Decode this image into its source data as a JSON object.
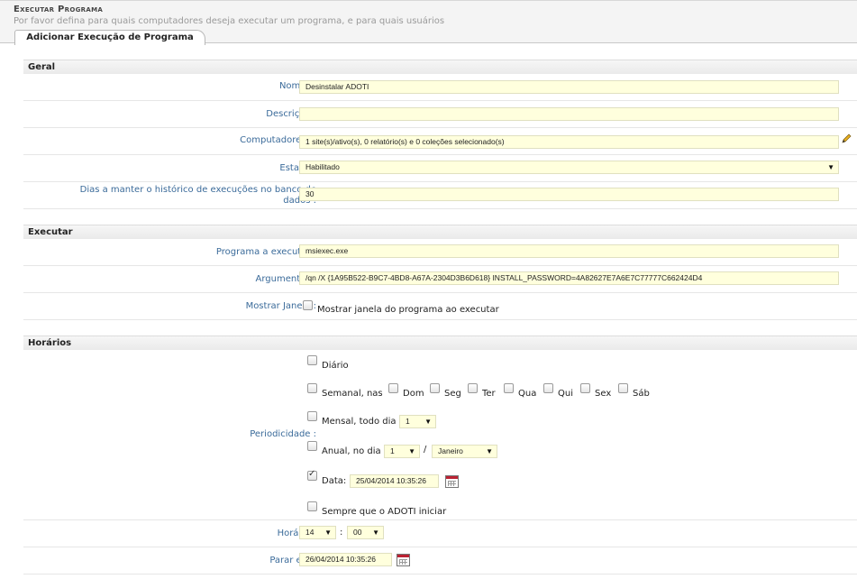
{
  "header": {
    "title": "Executar Programa",
    "subtitle": "Por favor defina para quais computadores deseja executar um programa, e para quais usuários",
    "tab": "Adicionar Execução de Programa"
  },
  "sections": {
    "geral": "Geral",
    "executar": "Executar",
    "horarios": "Horários"
  },
  "geral": {
    "nome_label": "Nome* :",
    "nome_value": "Desinstalar ADOTI",
    "descricao_label": "Descrição :",
    "descricao_value": "",
    "computadores_label": "Computadores* :",
    "computadores_value": "1 site(s)/ativo(s), 0 relatório(s) e 0 coleções selecionado(s)",
    "estado_label": "Estado :",
    "estado_value": "Habilitado",
    "dias_label": "Dias a manter o histórico de execuções no banco de dados :",
    "dias_value": "30"
  },
  "executar": {
    "programa_label": "Programa a executar :",
    "programa_value": "msiexec.exe",
    "argumentos_label": "Argumentos :",
    "argumentos_value": "/qn /X {1A95B522-B9C7-4BD8-A67A-2304D3B6D618} INSTALL_PASSWORD=4A82627E7A6E7C77777C662424D4",
    "janela_label": "Mostrar Janela :",
    "janela_checkbox": "Mostrar janela do programa ao executar"
  },
  "horarios": {
    "periodicidade_label": "Periodicidade :",
    "diario": "Diário",
    "semanal": "Semanal, nas",
    "days": [
      "Dom",
      "Seg",
      "Ter",
      "Qua",
      "Qui",
      "Sex",
      "Sáb"
    ],
    "mensal": "Mensal, todo dia",
    "mensal_day": "1",
    "anual": "Anual, no dia",
    "anual_day": "1",
    "slash": "/",
    "anual_month": "Janeiro",
    "data_label": "Data:",
    "data_value": "25/04/2014 10:35:26",
    "sempre": "Sempre que o ADOTI iniciar",
    "horario_label": "Horário :",
    "hora": "14",
    "colon": ":",
    "minuto": "00",
    "parar_label": "Parar em :",
    "parar_value": "26/04/2014 10:35:26"
  },
  "colors": {
    "label": "#3b6b9a",
    "input_bg": "#ffffdd"
  }
}
